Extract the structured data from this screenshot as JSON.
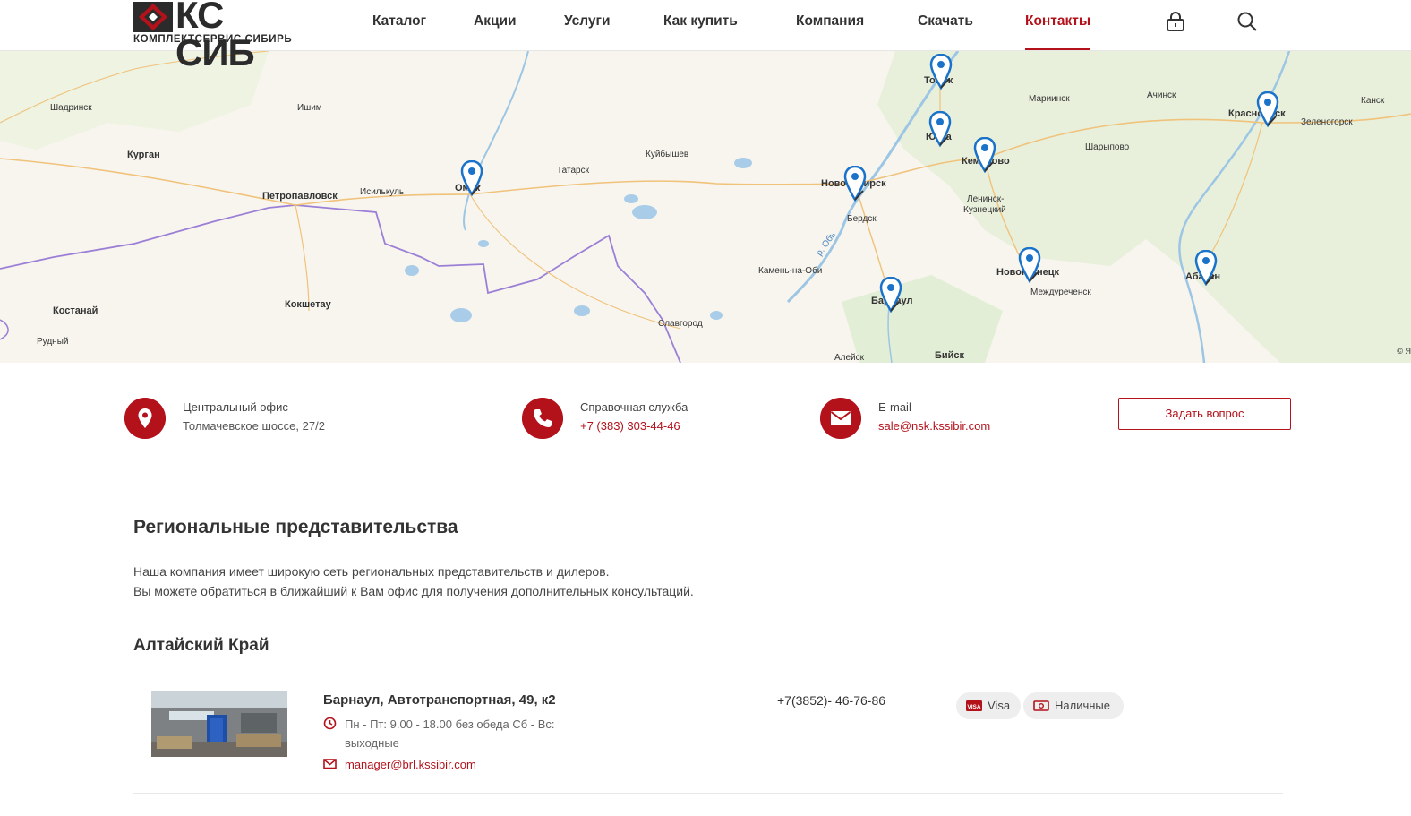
{
  "header": {
    "logo_text": "КС СИБ",
    "logo_sub": "КОМПЛЕКТСЕРВИС СИБИРЬ",
    "nav": [
      {
        "label": "Каталог"
      },
      {
        "label": "Акции"
      },
      {
        "label": "Услуги"
      },
      {
        "label": "Как купить"
      },
      {
        "label": "Компания"
      },
      {
        "label": "Скачать"
      },
      {
        "label": "Контакты",
        "active": true
      }
    ],
    "icons": [
      "lock-icon",
      "search-icon"
    ]
  },
  "map": {
    "cities": [
      {
        "name": "Шадринск"
      },
      {
        "name": "Ишим"
      },
      {
        "name": "Курган"
      },
      {
        "name": "Петропавловск"
      },
      {
        "name": "Исилькуль"
      },
      {
        "name": "Омск"
      },
      {
        "name": "Татарск"
      },
      {
        "name": "Куйбышев"
      },
      {
        "name": "Новосибирск"
      },
      {
        "name": "Бердск"
      },
      {
        "name": "Томск"
      },
      {
        "name": "Юрга"
      },
      {
        "name": "Кемерово"
      },
      {
        "name": "Мариинск"
      },
      {
        "name": "Ачинск"
      },
      {
        "name": "Красноярск"
      },
      {
        "name": "Канск"
      },
      {
        "name": "Зеленогорск"
      },
      {
        "name": "Шарыпово"
      },
      {
        "name": "Ленинск-"
      },
      {
        "name": "Кузнецкий"
      },
      {
        "name": "Камень-на-Оби"
      },
      {
        "name": "Барнаул"
      },
      {
        "name": "Новокузнецк"
      },
      {
        "name": "Междуреченск"
      },
      {
        "name": "Абакан"
      },
      {
        "name": "Костанай"
      },
      {
        "name": "Рудный"
      },
      {
        "name": "Кокшетау"
      },
      {
        "name": "Славгород"
      },
      {
        "name": "Алейск"
      },
      {
        "name": "Бийск"
      },
      {
        "name": "р. Обь"
      }
    ],
    "copyright": "© Я"
  },
  "contacts": {
    "office": {
      "title": "Центральный офис",
      "value": "Толмачевское шоссе, 27/2"
    },
    "phone": {
      "title": "Справочная служба",
      "value": "+7 (383) 303-44-46"
    },
    "email": {
      "title": "E-mail",
      "value": "sale@nsk.kssibir.com"
    },
    "ask_button": "Задать вопрос"
  },
  "regional": {
    "title": "Региональные представительства",
    "text_line1": "Наша компания имеет широкую сеть региональных представительств и дилеров.",
    "text_line2": "Вы можете обратиться в ближайший к Вам офис для получения дополнительных консультаций.",
    "region_title": "Алтайский Край",
    "office": {
      "title": "Барнаул, Автотранспортная, 49, к2",
      "hours": "Пн - Пт: 9.00 - 18.00 без обеда Сб - Вс: выходные",
      "email": "manager@brl.kssibir.com",
      "phone": "+7(3852)- 46-76-86",
      "payments": [
        {
          "label": "Visa",
          "icon": "visa-icon"
        },
        {
          "label": "Наличные",
          "icon": "cash-icon"
        }
      ]
    }
  }
}
